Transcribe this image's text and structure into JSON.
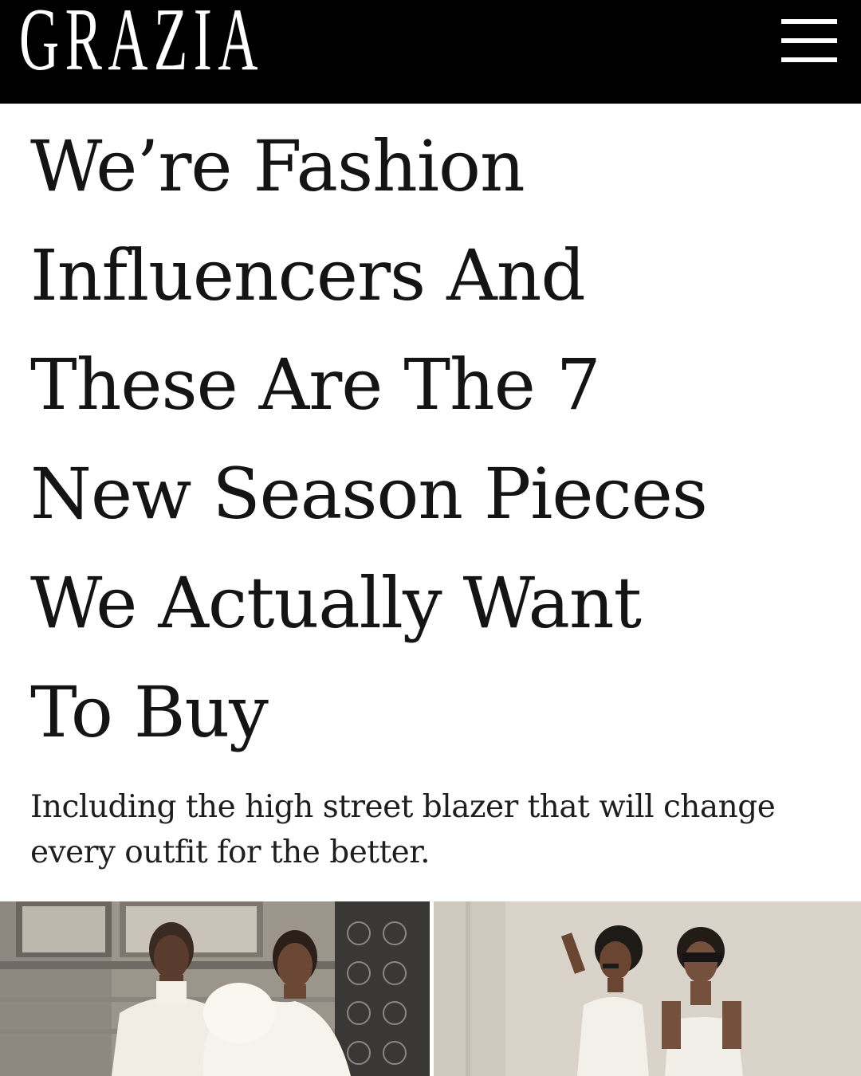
{
  "header": {
    "logo_text": "GRAZIA",
    "menu_icon": "hamburger-menu-icon",
    "background_color": "#000000"
  },
  "article": {
    "headline_lines": [
      "We’re Fashion",
      "Influencers And",
      "These Are The 7",
      "New Season Pieces",
      "We Actually Want",
      "To Buy"
    ],
    "standfirst_lines": [
      "Including the high street blazer that will change",
      "every outfit for the better."
    ]
  },
  "images": [
    {
      "name": "two women in white outfits standing outside a building"
    },
    {
      "name": "two women in white tops wearing sunglasses against a stone wall"
    }
  ]
}
